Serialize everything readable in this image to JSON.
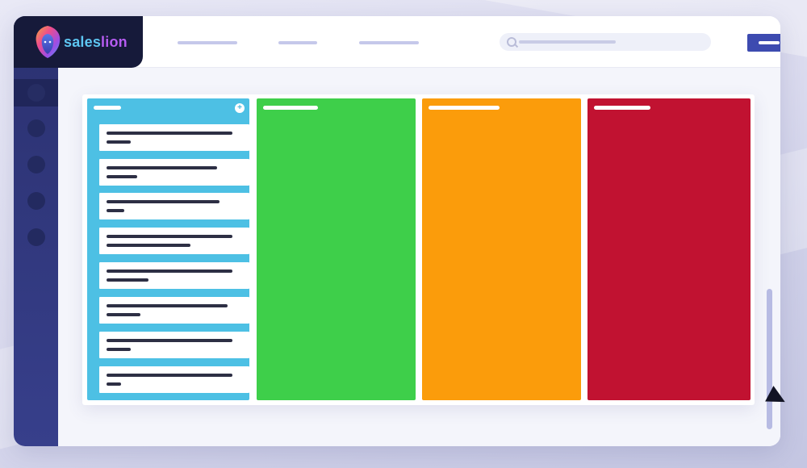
{
  "brand": {
    "name_part1": "sales",
    "name_part2": "lion",
    "logo_icon": "lion-head-icon"
  },
  "colors": {
    "sidebar": "#2e3477",
    "primary_button": "#3d4bb0",
    "column_new": "#4dc0e4",
    "column_won": "#3ecf4a",
    "column_pending": "#fb9c0b",
    "column_lost": "#c11231"
  },
  "sidebar": {
    "items": [
      {
        "icon": "nav-item-icon",
        "active": true
      },
      {
        "icon": "nav-item-icon",
        "active": false
      },
      {
        "icon": "nav-item-icon",
        "active": false
      },
      {
        "icon": "nav-item-icon",
        "active": false
      },
      {
        "icon": "nav-item-icon",
        "active": false
      }
    ]
  },
  "header": {
    "nav_links": 3,
    "search_icon": "search-icon",
    "action_button": "primary-button"
  },
  "board": {
    "columns": [
      {
        "color": "#4dc0e4",
        "has_add": true,
        "add_label": "+",
        "cards": 8
      },
      {
        "color": "#3ecf4a",
        "has_add": false,
        "cards": 0
      },
      {
        "color": "#fb9c0b",
        "has_add": false,
        "cards": 0
      },
      {
        "color": "#c11231",
        "has_add": false,
        "cards": 0
      }
    ]
  }
}
